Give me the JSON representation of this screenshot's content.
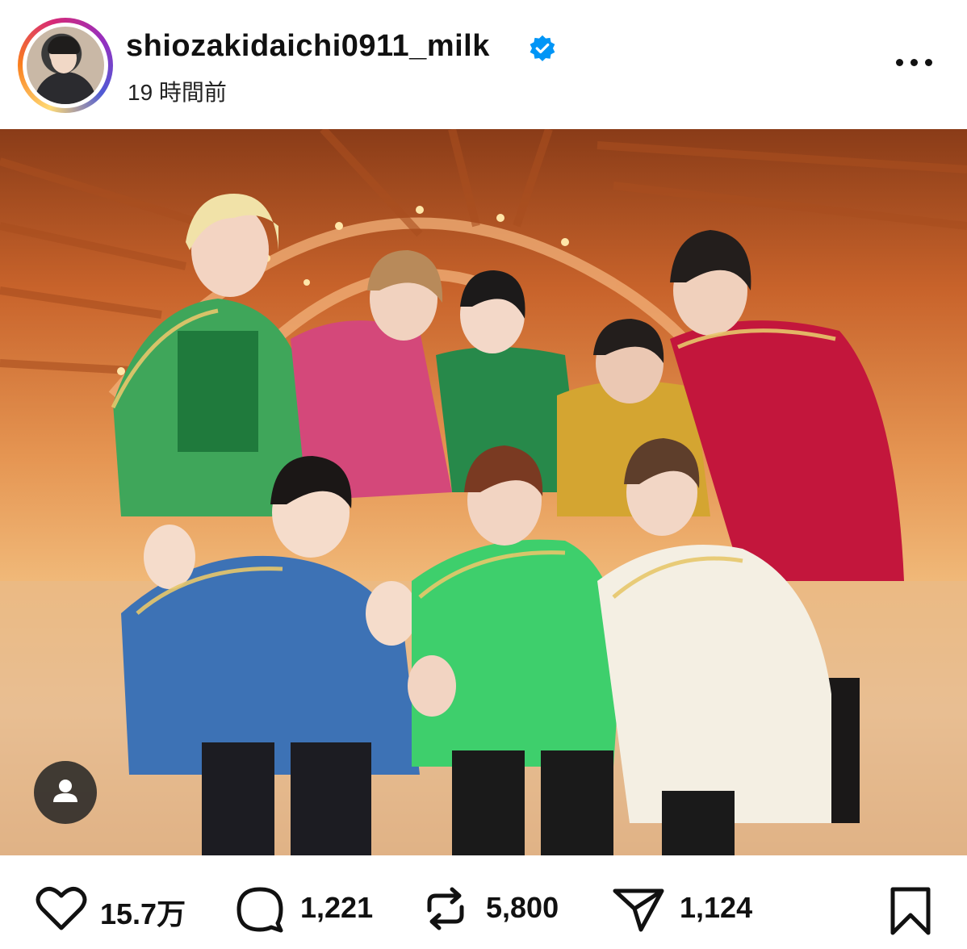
{
  "post": {
    "username": "shiozakidaichi0911_milk",
    "verified": true,
    "timestamp": "19 時間前",
    "more_icon": "more-horizontal-icon"
  },
  "media": {
    "type": "photo",
    "user_tag_icon": "person-icon"
  },
  "actions": {
    "likes": "15.7万",
    "comments": "1,221",
    "reposts": "5,800",
    "shares": "1,124",
    "icons": [
      "heart-icon",
      "comment-icon",
      "repost-icon",
      "send-icon",
      "bookmark-icon"
    ]
  },
  "colors": {
    "verified_blue": "#0095f6",
    "text": "#111111"
  }
}
